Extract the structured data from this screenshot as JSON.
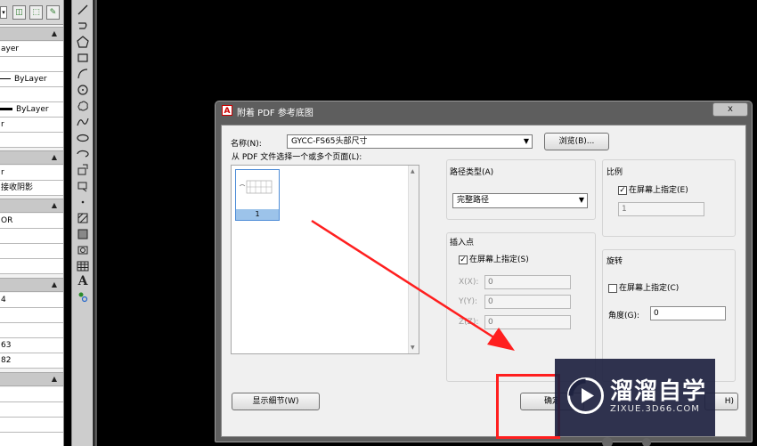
{
  "properties_panel": {
    "rows": [
      {
        "text": "ayer",
        "line": "none"
      },
      {
        "text": "ByLayer",
        "line": "thin"
      },
      {
        "text": "ByLayer",
        "line": "thick"
      },
      {
        "text": "r",
        "line": "none"
      },
      {
        "text": "r",
        "line": "none"
      },
      {
        "text": "接收阴影",
        "line": "none"
      },
      {
        "text": "OR",
        "line": "none"
      },
      {
        "text": "4",
        "line": "none"
      },
      {
        "text": "63",
        "line": "none"
      },
      {
        "text": "82",
        "line": "none"
      }
    ],
    "collapse_glyph": "▲"
  },
  "dialog": {
    "title": "附着 PDF 参考底图",
    "close_label": "x",
    "name_label": "名称(N):",
    "name_value": "GYCC-FS65头部尺寸",
    "browse_button": "浏览(B)...",
    "pages_label": "从 PDF 文件选择一个或多个页面(L):",
    "page_thumb_caption": "1",
    "path_type": {
      "group_label": "路径类型(A)",
      "value": "完整路径"
    },
    "insertion_point": {
      "group_label": "插入点",
      "specify_on_screen": "在屏幕上指定(S)",
      "checked": true,
      "x_label": "X(X):",
      "x_value": "0",
      "y_label": "Y(Y):",
      "y_value": "0",
      "z_label": "Z(Z):",
      "z_value": "0"
    },
    "scale": {
      "group_label": "比例",
      "specify_on_screen": "在屏幕上指定(E)",
      "checked": true,
      "value": "1"
    },
    "rotation": {
      "group_label": "旋转",
      "specify_on_screen": "在屏幕上指定(C)",
      "checked": false,
      "angle_label": "角度(G):",
      "angle_value": "0"
    },
    "details_button": "显示细节(W)",
    "ok_button_partial": "确定",
    "help_button_partial": "H)"
  },
  "watermark": {
    "brand": "溜溜自学",
    "url": "ZIXUE.3D66.COM"
  },
  "colors": {
    "annotation_red": "#ff1f1f",
    "watermark_bg": "#1e2240",
    "selection_blue": "#9cc3ea"
  }
}
